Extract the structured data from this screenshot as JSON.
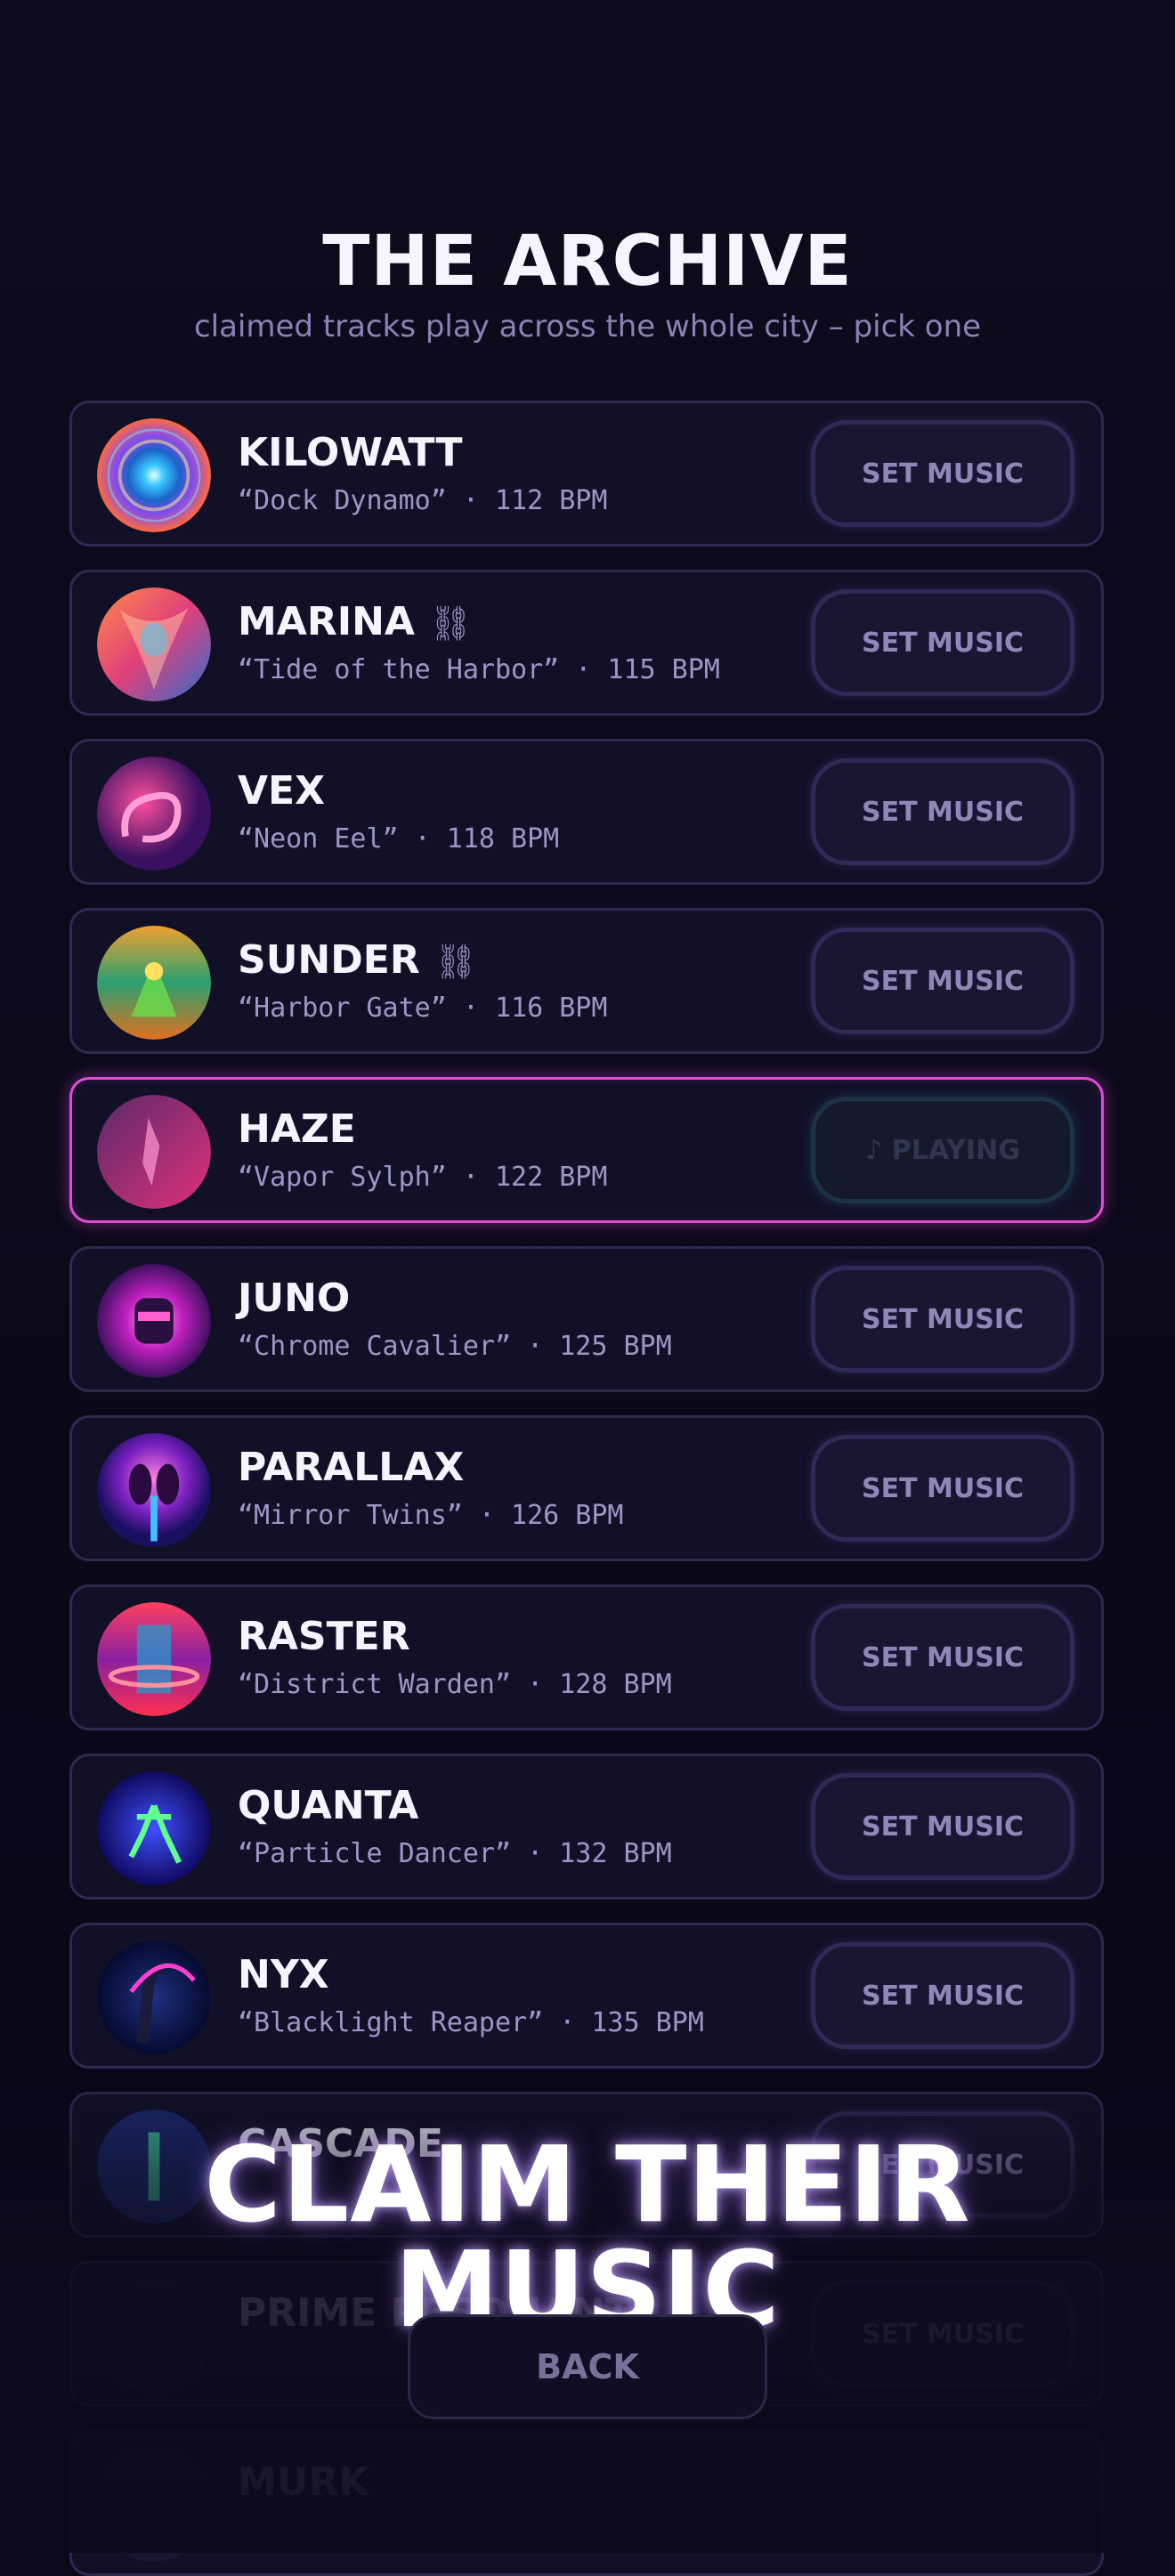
{
  "header": {
    "title": "THE ARCHIVE",
    "subtitle": "claimed tracks play across the whole city – pick one"
  },
  "tracks": [
    {
      "name": "KILOWATT",
      "linked": false,
      "meta": "“Dock Dynamo” · 112 BPM",
      "action": "SET MUSIC",
      "state": "idle"
    },
    {
      "name": "MARINA",
      "linked": true,
      "meta": "“Tide of the Harbor” · 115 BPM",
      "action": "SET MUSIC",
      "state": "idle"
    },
    {
      "name": "VEX",
      "linked": false,
      "meta": "“Neon Eel” · 118 BPM",
      "action": "SET MUSIC",
      "state": "idle"
    },
    {
      "name": "SUNDER",
      "linked": true,
      "meta": "“Harbor Gate” · 116 BPM",
      "action": "SET MUSIC",
      "state": "idle"
    },
    {
      "name": "HAZE",
      "linked": false,
      "meta": "“Vapor Sylph” · 122 BPM",
      "action": "♪ PLAYING",
      "state": "playing"
    },
    {
      "name": "JUNO",
      "linked": false,
      "meta": "“Chrome Cavalier” · 125 BPM",
      "action": "SET MUSIC",
      "state": "idle"
    },
    {
      "name": "PARALLAX",
      "linked": false,
      "meta": "“Mirror Twins” · 126 BPM",
      "action": "SET MUSIC",
      "state": "idle"
    },
    {
      "name": "RASTER",
      "linked": false,
      "meta": "“District Warden” · 128 BPM",
      "action": "SET MUSIC",
      "state": "idle"
    },
    {
      "name": "QUANTA",
      "linked": false,
      "meta": "“Particle Dancer” · 132 BPM",
      "action": "SET MUSIC",
      "state": "idle"
    },
    {
      "name": "NYX",
      "linked": false,
      "meta": "“Blacklight Reaper” · 135 BPM",
      "action": "SET MUSIC",
      "state": "idle"
    },
    {
      "name": "CASCADE",
      "linked": false,
      "meta": "",
      "action": "SET MUSIC",
      "state": "idle"
    },
    {
      "name": "PRIME RESONANT",
      "linked": false,
      "meta": "",
      "action": "SET MUSIC",
      "state": "idle"
    },
    {
      "name": "MURK",
      "linked": false,
      "meta": "",
      "action": "",
      "state": "idle"
    }
  ],
  "link_icon": "⛓",
  "overlay": {
    "banner": "CLAIM THEIR MUSIC"
  },
  "footer": {
    "back_label": "BACK"
  },
  "colors": {
    "accent_playing": "#e24bd8",
    "background": "#0c0a1a",
    "row_border": "#2e2a52"
  }
}
